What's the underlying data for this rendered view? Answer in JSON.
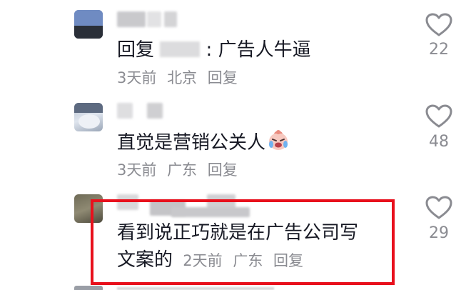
{
  "comments": [
    {
      "reply_prefix": "回复",
      "reply_suffix": ": 广告人牛逼",
      "text": "",
      "meta": {
        "time": "3天前",
        "location": "北京",
        "reply": "回复"
      },
      "likes": "22",
      "avatar_icon": "avatar-image",
      "like_icon": "heart-outline-icon"
    },
    {
      "text": "直觉是营销公关人",
      "emoji_icon": "crying-laughing-emoji-icon",
      "meta": {
        "time": "3天前",
        "location": "广东",
        "reply": "回复"
      },
      "likes": "48",
      "avatar_icon": "avatar-image",
      "like_icon": "heart-outline-icon"
    },
    {
      "text_line1": "看到说正巧就是在广告公司写",
      "text_line2": "文案的",
      "meta": {
        "time": "2天前",
        "location": "广东",
        "reply": "回复"
      },
      "likes": "29",
      "avatar_icon": "avatar-image",
      "like_icon": "heart-outline-icon",
      "highlighted": true
    }
  ],
  "colors": {
    "highlight_border": "#e8101c",
    "meta_text": "#8a8b91",
    "main_text": "#161823"
  }
}
